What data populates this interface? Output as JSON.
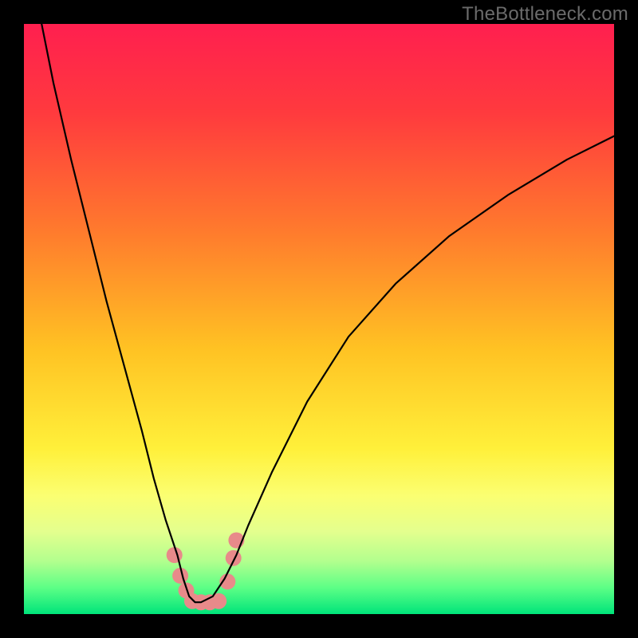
{
  "watermark": "TheBottleneck.com",
  "chart_data": {
    "type": "line",
    "title": "",
    "xlabel": "",
    "ylabel": "",
    "xlim": [
      0,
      100
    ],
    "ylim": [
      0,
      100
    ],
    "grid": false,
    "background_gradient_stops": [
      {
        "offset": 0.0,
        "color": "#ff1f4f"
      },
      {
        "offset": 0.15,
        "color": "#ff3a3e"
      },
      {
        "offset": 0.35,
        "color": "#ff7a2d"
      },
      {
        "offset": 0.55,
        "color": "#ffc223"
      },
      {
        "offset": 0.72,
        "color": "#fff03a"
      },
      {
        "offset": 0.8,
        "color": "#fbff72"
      },
      {
        "offset": 0.86,
        "color": "#e4ff8e"
      },
      {
        "offset": 0.91,
        "color": "#b3ff8e"
      },
      {
        "offset": 0.955,
        "color": "#5dff86"
      },
      {
        "offset": 1.0,
        "color": "#00e47a"
      }
    ],
    "series": [
      {
        "name": "bottleneck-curve",
        "stroke": "#000000",
        "stroke_width": 2.2,
        "x": [
          3,
          5,
          8,
          11,
          14,
          17,
          20,
          22,
          24,
          26,
          27,
          28,
          29,
          30,
          32,
          34,
          36,
          38,
          42,
          48,
          55,
          63,
          72,
          82,
          92,
          100
        ],
        "y": [
          100,
          90,
          77,
          65,
          53,
          42,
          31,
          23,
          16,
          10,
          6,
          3,
          2,
          2,
          3,
          6,
          10,
          15,
          24,
          36,
          47,
          56,
          64,
          71,
          77,
          81
        ]
      }
    ],
    "markers": {
      "name": "highlight-dots",
      "color": "#e88a8a",
      "radius": 10,
      "points": [
        {
          "x": 25.5,
          "y": 10
        },
        {
          "x": 26.5,
          "y": 6.5
        },
        {
          "x": 27.5,
          "y": 4
        },
        {
          "x": 28.5,
          "y": 2.2
        },
        {
          "x": 30.0,
          "y": 2.0
        },
        {
          "x": 31.5,
          "y": 2.0
        },
        {
          "x": 33.0,
          "y": 2.2
        },
        {
          "x": 34.5,
          "y": 5.5
        },
        {
          "x": 35.5,
          "y": 9.5
        },
        {
          "x": 36.0,
          "y": 12.5
        }
      ]
    }
  }
}
